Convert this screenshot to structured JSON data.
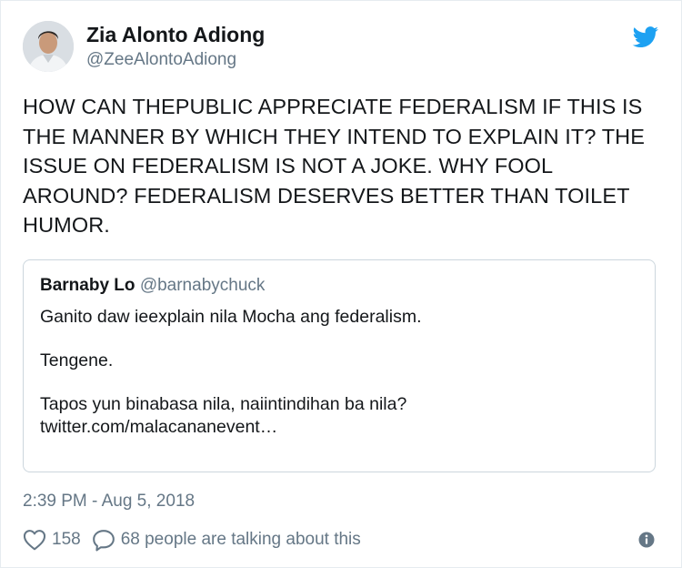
{
  "author": {
    "display_name": "Zia Alonto Adiong",
    "handle": "@ZeeAlontoAdiong"
  },
  "tweet": {
    "text": "HOW CAN THEPUBLIC APPRECIATE FEDERALISM IF THIS IS THE MANNER BY WHICH THEY INTEND TO EXPLAIN IT? THE ISSUE ON FEDERALISM IS NOT A JOKE. WHY FOOL AROUND? FEDERALISM DESERVES BETTER THAN TOILET HUMOR.",
    "timestamp": "2:39 PM - Aug 5, 2018"
  },
  "quoted_tweet": {
    "display_name": "Barnaby Lo",
    "handle": "@barnabychuck",
    "line1": "Ganito daw ieexplain nila Mocha ang federalism.",
    "line2": "Tengene.",
    "line3": "Tapos yun binabasa nila, naiintindihan ba nila?",
    "link": "twitter.com/malacananevent…"
  },
  "actions": {
    "likes": "158",
    "talking": "68 people are talking about this"
  },
  "icons": {
    "brand": "twitter-bird-icon",
    "like": "heart-icon",
    "reply": "speech-bubble-icon",
    "info": "info-icon"
  },
  "colors": {
    "twitter_blue": "#1da1f2",
    "secondary_text": "#657786",
    "primary_text": "#14171a",
    "border": "#ccd6dd"
  }
}
